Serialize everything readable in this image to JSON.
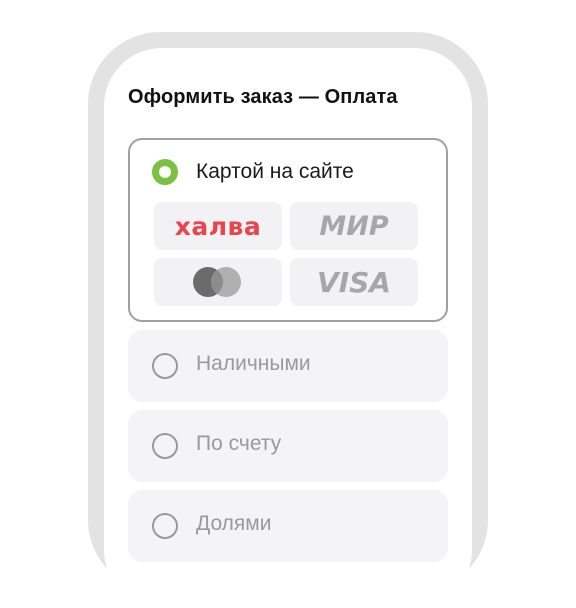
{
  "header": {
    "title": "Оформить заказ — Оплата"
  },
  "payment_methods": {
    "card": {
      "label": "Картой на сайте",
      "selected": true,
      "brands": [
        {
          "name": "halva-logo",
          "text": "халва",
          "color": "#e8454f"
        },
        {
          "name": "mir-logo",
          "text": "МИР",
          "color": "#a7a7a9"
        },
        {
          "name": "mastercard-logo",
          "text": "",
          "color": "#6b6b6b"
        },
        {
          "name": "visa-logo",
          "text": "VISA",
          "color": "#a7a7a9"
        }
      ]
    },
    "cash": {
      "label": "Наличными",
      "selected": false
    },
    "invoice": {
      "label": "По счету",
      "selected": false
    },
    "installments": {
      "label": "Долями",
      "selected": false
    }
  },
  "colors": {
    "accent": "#7ac142",
    "selected_border": "#a0a0a0",
    "card_bg": "#f4f4f6",
    "muted_text": "#9a9a9a",
    "frame": "#e3e3e3"
  }
}
